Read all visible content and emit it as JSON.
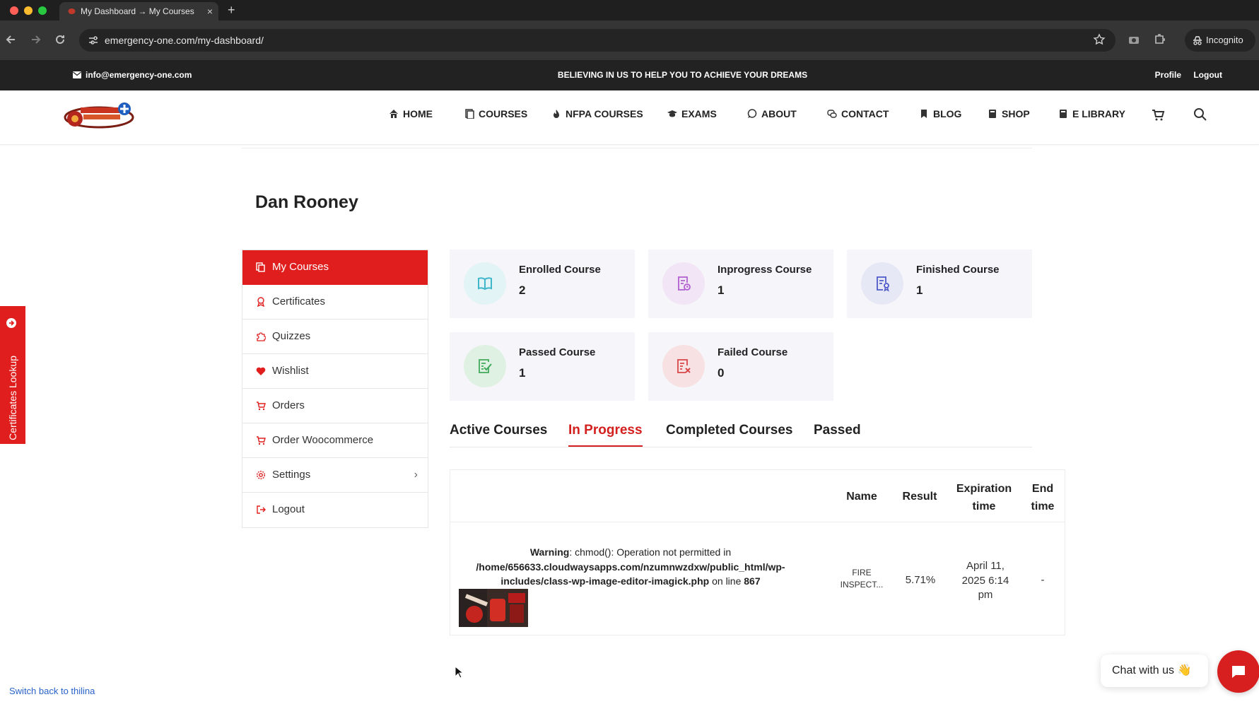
{
  "browser": {
    "tab_title": "My Dashboard → My Courses",
    "tab_close": "×",
    "new_tab": "+",
    "url": "emergency-one.com/my-dashboard/",
    "incognito_label": "Incognito",
    "icons": [
      "back-icon",
      "forward-icon",
      "reload-icon",
      "site-settings-icon",
      "bookmark-star-icon",
      "camera-icon",
      "extensions-icon",
      "incognito-icon"
    ]
  },
  "topbar": {
    "email": "info@emergency-one.com",
    "tagline": "BELIEVING IN US TO HELP YOU TO ACHIEVE YOUR DREAMS",
    "profile": "Profile",
    "logout": "Logout"
  },
  "nav": {
    "items": [
      {
        "label": "HOME",
        "icon": "home-icon"
      },
      {
        "label": "COURSES",
        "icon": "courses-icon"
      },
      {
        "label": "NFPA COURSES",
        "icon": "fire-icon"
      },
      {
        "label": "EXAMS",
        "icon": "graduation-cap-icon"
      },
      {
        "label": "ABOUT",
        "icon": "chat-bubble-icon"
      },
      {
        "label": "CONTACT",
        "icon": "chat-bubbles-icon"
      },
      {
        "label": "BLOG",
        "icon": "bookmark-icon"
      },
      {
        "label": "SHOP",
        "icon": "store-icon"
      },
      {
        "label": "E LIBRARY",
        "icon": "book-icon"
      }
    ],
    "cart_icon": "cart-icon",
    "search_icon": "search-icon"
  },
  "user": {
    "name": "Dan Rooney"
  },
  "sidebar": {
    "items": [
      {
        "label": "My Courses",
        "icon": "courses-icon",
        "active": true
      },
      {
        "label": "Certificates",
        "icon": "award-icon"
      },
      {
        "label": "Quizzes",
        "icon": "puzzle-icon"
      },
      {
        "label": "Wishlist",
        "icon": "heart-icon"
      },
      {
        "label": "Orders",
        "icon": "cart-icon"
      },
      {
        "label": "Order Woocommerce",
        "icon": "cart-icon"
      },
      {
        "label": "Settings",
        "icon": "gear-icon"
      },
      {
        "label": "Logout",
        "icon": "logout-icon"
      }
    ],
    "settings_chevron": "›"
  },
  "stats": [
    {
      "label": "Enrolled Course",
      "value": "2",
      "icon": "open-book-icon",
      "color": "#3fb6c9",
      "bg": "#e3f4f6"
    },
    {
      "label": "Inprogress Course",
      "value": "1",
      "icon": "document-clock-icon",
      "color": "#b15fd0",
      "bg": "#f1e5f6"
    },
    {
      "label": "Finished Course",
      "value": "1",
      "icon": "document-award-icon",
      "color": "#4f59c9",
      "bg": "#e6e8f6"
    },
    {
      "label": "Passed Course",
      "value": "1",
      "icon": "document-check-icon",
      "color": "#43a95a",
      "bg": "#dff1e2"
    },
    {
      "label": "Failed Course",
      "value": "0",
      "icon": "document-x-icon",
      "color": "#d8474a",
      "bg": "#f7e1e2"
    }
  ],
  "tabs": [
    {
      "label": "Active Courses"
    },
    {
      "label": "In Progress",
      "active": true
    },
    {
      "label": "Completed Courses"
    },
    {
      "label": "Passed"
    }
  ],
  "table": {
    "headers": {
      "name": "Name",
      "result": "Result",
      "expiration_1": "Expiration",
      "expiration_2": "time",
      "end_1": "End",
      "end_2": "time"
    },
    "row": {
      "warning_label": "Warning",
      "warning_text": ": chmod(): Operation not permitted in",
      "warning_path": "/home/656633.cloudwaysapps.com/nzumnwzdxw/public_html/wp-includes/class-wp-image-editor-imagick.php",
      "warning_on_line": " on line ",
      "warning_line": "867",
      "name_1": "FIRE",
      "name_2": "INSPECT...",
      "result": "5.71%",
      "expiration_1": "April 11,",
      "expiration_2": "2025 6:14",
      "expiration_3": "pm",
      "end_time": "-"
    }
  },
  "floating": {
    "cert_lookup": "Certificates Lookup",
    "chat_label": "Chat with us",
    "chat_emoji": "👋",
    "switch_back": "Switch back to thilina"
  },
  "colors": {
    "accent": "#e01e1e",
    "link": "#2962c8"
  }
}
